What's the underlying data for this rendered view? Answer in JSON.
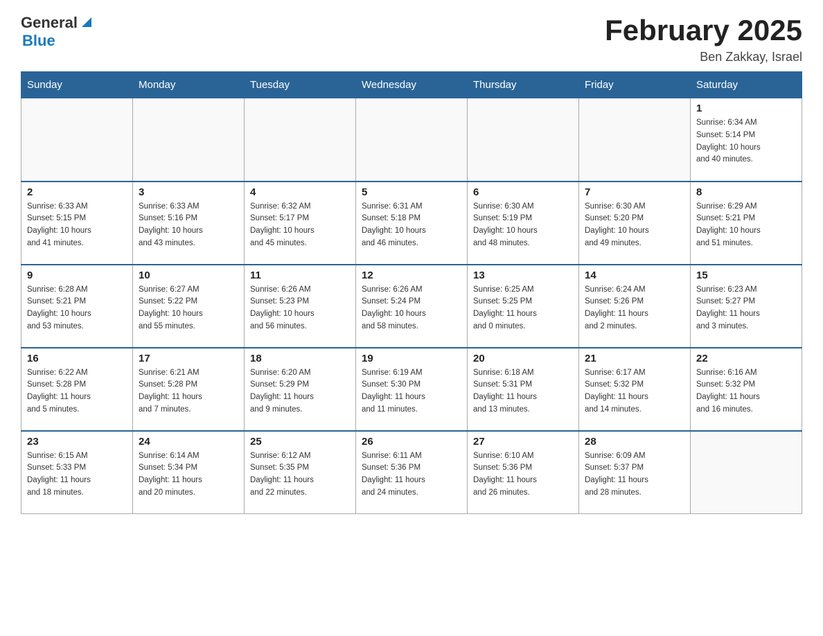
{
  "header": {
    "logo_general": "General",
    "logo_blue": "Blue",
    "month_title": "February 2025",
    "location": "Ben Zakkay, Israel"
  },
  "days_of_week": [
    "Sunday",
    "Monday",
    "Tuesday",
    "Wednesday",
    "Thursday",
    "Friday",
    "Saturday"
  ],
  "weeks": [
    [
      {
        "day": "",
        "info": ""
      },
      {
        "day": "",
        "info": ""
      },
      {
        "day": "",
        "info": ""
      },
      {
        "day": "",
        "info": ""
      },
      {
        "day": "",
        "info": ""
      },
      {
        "day": "",
        "info": ""
      },
      {
        "day": "1",
        "info": "Sunrise: 6:34 AM\nSunset: 5:14 PM\nDaylight: 10 hours\nand 40 minutes."
      }
    ],
    [
      {
        "day": "2",
        "info": "Sunrise: 6:33 AM\nSunset: 5:15 PM\nDaylight: 10 hours\nand 41 minutes."
      },
      {
        "day": "3",
        "info": "Sunrise: 6:33 AM\nSunset: 5:16 PM\nDaylight: 10 hours\nand 43 minutes."
      },
      {
        "day": "4",
        "info": "Sunrise: 6:32 AM\nSunset: 5:17 PM\nDaylight: 10 hours\nand 45 minutes."
      },
      {
        "day": "5",
        "info": "Sunrise: 6:31 AM\nSunset: 5:18 PM\nDaylight: 10 hours\nand 46 minutes."
      },
      {
        "day": "6",
        "info": "Sunrise: 6:30 AM\nSunset: 5:19 PM\nDaylight: 10 hours\nand 48 minutes."
      },
      {
        "day": "7",
        "info": "Sunrise: 6:30 AM\nSunset: 5:20 PM\nDaylight: 10 hours\nand 49 minutes."
      },
      {
        "day": "8",
        "info": "Sunrise: 6:29 AM\nSunset: 5:21 PM\nDaylight: 10 hours\nand 51 minutes."
      }
    ],
    [
      {
        "day": "9",
        "info": "Sunrise: 6:28 AM\nSunset: 5:21 PM\nDaylight: 10 hours\nand 53 minutes."
      },
      {
        "day": "10",
        "info": "Sunrise: 6:27 AM\nSunset: 5:22 PM\nDaylight: 10 hours\nand 55 minutes."
      },
      {
        "day": "11",
        "info": "Sunrise: 6:26 AM\nSunset: 5:23 PM\nDaylight: 10 hours\nand 56 minutes."
      },
      {
        "day": "12",
        "info": "Sunrise: 6:26 AM\nSunset: 5:24 PM\nDaylight: 10 hours\nand 58 minutes."
      },
      {
        "day": "13",
        "info": "Sunrise: 6:25 AM\nSunset: 5:25 PM\nDaylight: 11 hours\nand 0 minutes."
      },
      {
        "day": "14",
        "info": "Sunrise: 6:24 AM\nSunset: 5:26 PM\nDaylight: 11 hours\nand 2 minutes."
      },
      {
        "day": "15",
        "info": "Sunrise: 6:23 AM\nSunset: 5:27 PM\nDaylight: 11 hours\nand 3 minutes."
      }
    ],
    [
      {
        "day": "16",
        "info": "Sunrise: 6:22 AM\nSunset: 5:28 PM\nDaylight: 11 hours\nand 5 minutes."
      },
      {
        "day": "17",
        "info": "Sunrise: 6:21 AM\nSunset: 5:28 PM\nDaylight: 11 hours\nand 7 minutes."
      },
      {
        "day": "18",
        "info": "Sunrise: 6:20 AM\nSunset: 5:29 PM\nDaylight: 11 hours\nand 9 minutes."
      },
      {
        "day": "19",
        "info": "Sunrise: 6:19 AM\nSunset: 5:30 PM\nDaylight: 11 hours\nand 11 minutes."
      },
      {
        "day": "20",
        "info": "Sunrise: 6:18 AM\nSunset: 5:31 PM\nDaylight: 11 hours\nand 13 minutes."
      },
      {
        "day": "21",
        "info": "Sunrise: 6:17 AM\nSunset: 5:32 PM\nDaylight: 11 hours\nand 14 minutes."
      },
      {
        "day": "22",
        "info": "Sunrise: 6:16 AM\nSunset: 5:32 PM\nDaylight: 11 hours\nand 16 minutes."
      }
    ],
    [
      {
        "day": "23",
        "info": "Sunrise: 6:15 AM\nSunset: 5:33 PM\nDaylight: 11 hours\nand 18 minutes."
      },
      {
        "day": "24",
        "info": "Sunrise: 6:14 AM\nSunset: 5:34 PM\nDaylight: 11 hours\nand 20 minutes."
      },
      {
        "day": "25",
        "info": "Sunrise: 6:12 AM\nSunset: 5:35 PM\nDaylight: 11 hours\nand 22 minutes."
      },
      {
        "day": "26",
        "info": "Sunrise: 6:11 AM\nSunset: 5:36 PM\nDaylight: 11 hours\nand 24 minutes."
      },
      {
        "day": "27",
        "info": "Sunrise: 6:10 AM\nSunset: 5:36 PM\nDaylight: 11 hours\nand 26 minutes."
      },
      {
        "day": "28",
        "info": "Sunrise: 6:09 AM\nSunset: 5:37 PM\nDaylight: 11 hours\nand 28 minutes."
      },
      {
        "day": "",
        "info": ""
      }
    ]
  ]
}
